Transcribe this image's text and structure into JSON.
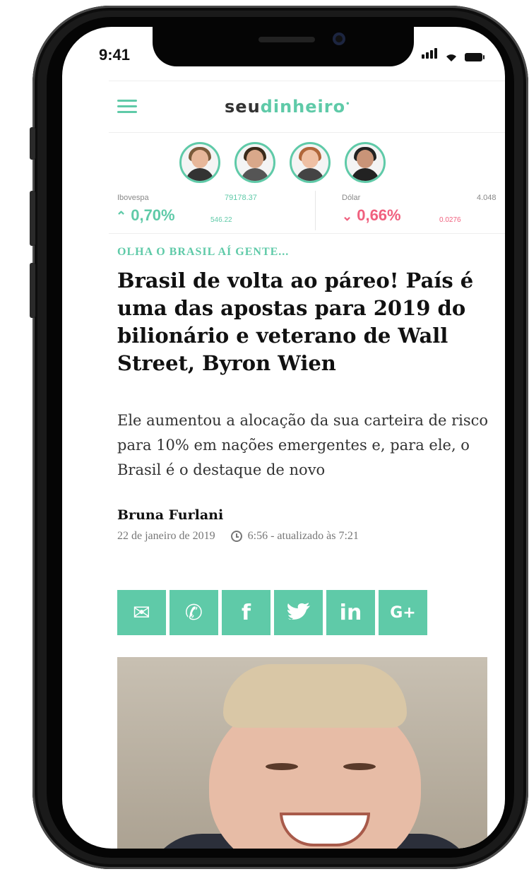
{
  "status_bar": {
    "time": "9:41"
  },
  "header": {
    "logo_part1": "seu",
    "logo_part2": "dinheiro",
    "logo_mark": "•"
  },
  "columnists": [
    {
      "name": "columnist-1"
    },
    {
      "name": "columnist-2"
    },
    {
      "name": "columnist-3"
    },
    {
      "name": "columnist-4"
    }
  ],
  "ticker": {
    "ibovespa": {
      "label": "Ibovespa",
      "value": "79178.37",
      "change": "0,70%",
      "points": "546.22",
      "direction": "up",
      "color": "#5fcaa8"
    },
    "dolar": {
      "label": "Dólar",
      "value": "4.048",
      "change": "0,66%",
      "points": "0.0276",
      "direction": "down",
      "color": "#f0607e"
    }
  },
  "article": {
    "kicker": "OLHA O BRASIL AÍ GENTE...",
    "title": "Brasil de volta ao páreo! País é uma das apostas para 2019 do bilionário e veterano de Wall Street, Byron Wien",
    "lead": "Ele aumentou a alocação da sua carteira de risco para 10% em nações emergentes e, para ele, o Brasil é o destaque de novo",
    "author": "Bruna Furlani",
    "date": "22 de janeiro de 2019",
    "time": "6:56 - atualizado às 7:21"
  },
  "share": [
    {
      "icon": "email-icon",
      "glyph": "✉"
    },
    {
      "icon": "whatsapp-icon",
      "glyph": "✆"
    },
    {
      "icon": "facebook-icon",
      "glyph": "f"
    },
    {
      "icon": "twitter-icon",
      "glyph": "🐦"
    },
    {
      "icon": "linkedin-icon",
      "glyph": "in"
    },
    {
      "icon": "googleplus-icon",
      "glyph": "G+"
    }
  ],
  "colors": {
    "accent": "#5fcaa8",
    "negative": "#f0607e"
  }
}
